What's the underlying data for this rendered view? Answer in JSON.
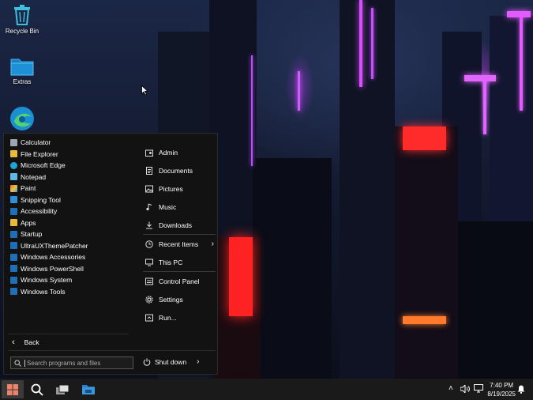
{
  "desktop": {
    "icons": [
      {
        "label": "Recycle Bin",
        "icon": "recycle-bin-icon"
      },
      {
        "label": "Extras",
        "icon": "folder-icon"
      },
      {
        "label": "",
        "icon": "edge-icon"
      }
    ]
  },
  "start_menu": {
    "left_items": [
      {
        "label": "Calculator",
        "icon": "calculator-icon",
        "color": "#9aa6b2"
      },
      {
        "label": "File Explorer",
        "icon": "folder-icon",
        "color": "#e8b93a"
      },
      {
        "label": "Microsoft Edge",
        "icon": "edge-icon",
        "color": "#1fa4d6"
      },
      {
        "label": "Notepad",
        "icon": "notepad-icon",
        "color": "#5fb7e8"
      },
      {
        "label": "Paint",
        "icon": "paint-icon",
        "color": "#e86a3a"
      },
      {
        "label": "Snipping Tool",
        "icon": "snipping-icon",
        "color": "#2f8fdd"
      },
      {
        "label": "Accessibility",
        "icon": "folder-icon",
        "color": "#1f6fb8"
      },
      {
        "label": "Apps",
        "icon": "folder-icon",
        "color": "#e8b93a"
      },
      {
        "label": "Startup",
        "icon": "folder-icon",
        "color": "#1f6fb8"
      },
      {
        "label": "UltraUXThemePatcher",
        "icon": "folder-icon",
        "color": "#1f6fb8"
      },
      {
        "label": "Windows Accessories",
        "icon": "folder-icon",
        "color": "#1f6fb8"
      },
      {
        "label": "Windows PowerShell",
        "icon": "folder-icon",
        "color": "#1f6fb8"
      },
      {
        "label": "Windows System",
        "icon": "folder-icon",
        "color": "#1f6fb8"
      },
      {
        "label": "Windows Tools",
        "icon": "folder-icon",
        "color": "#1f6fb8"
      }
    ],
    "right_items": [
      {
        "label": "Admin",
        "icon": "user-folder-icon"
      },
      {
        "label": "Documents",
        "icon": "documents-icon"
      },
      {
        "label": "Pictures",
        "icon": "pictures-icon"
      },
      {
        "label": "Music",
        "icon": "music-icon"
      },
      {
        "label": "Downloads",
        "icon": "downloads-icon"
      },
      {
        "label": "Recent Items",
        "icon": "recent-icon"
      },
      {
        "label": "This PC",
        "icon": "pc-icon"
      },
      {
        "label": "Control Panel",
        "icon": "control-panel-icon"
      },
      {
        "label": "Settings",
        "icon": "settings-icon"
      },
      {
        "label": "Run...",
        "icon": "run-icon"
      }
    ],
    "back_label": "Back",
    "search_placeholder": "Search programs and files",
    "shutdown_label": "Shut down"
  },
  "taskbar": {
    "time": "7:40 PM",
    "date": "8/19/2025"
  }
}
